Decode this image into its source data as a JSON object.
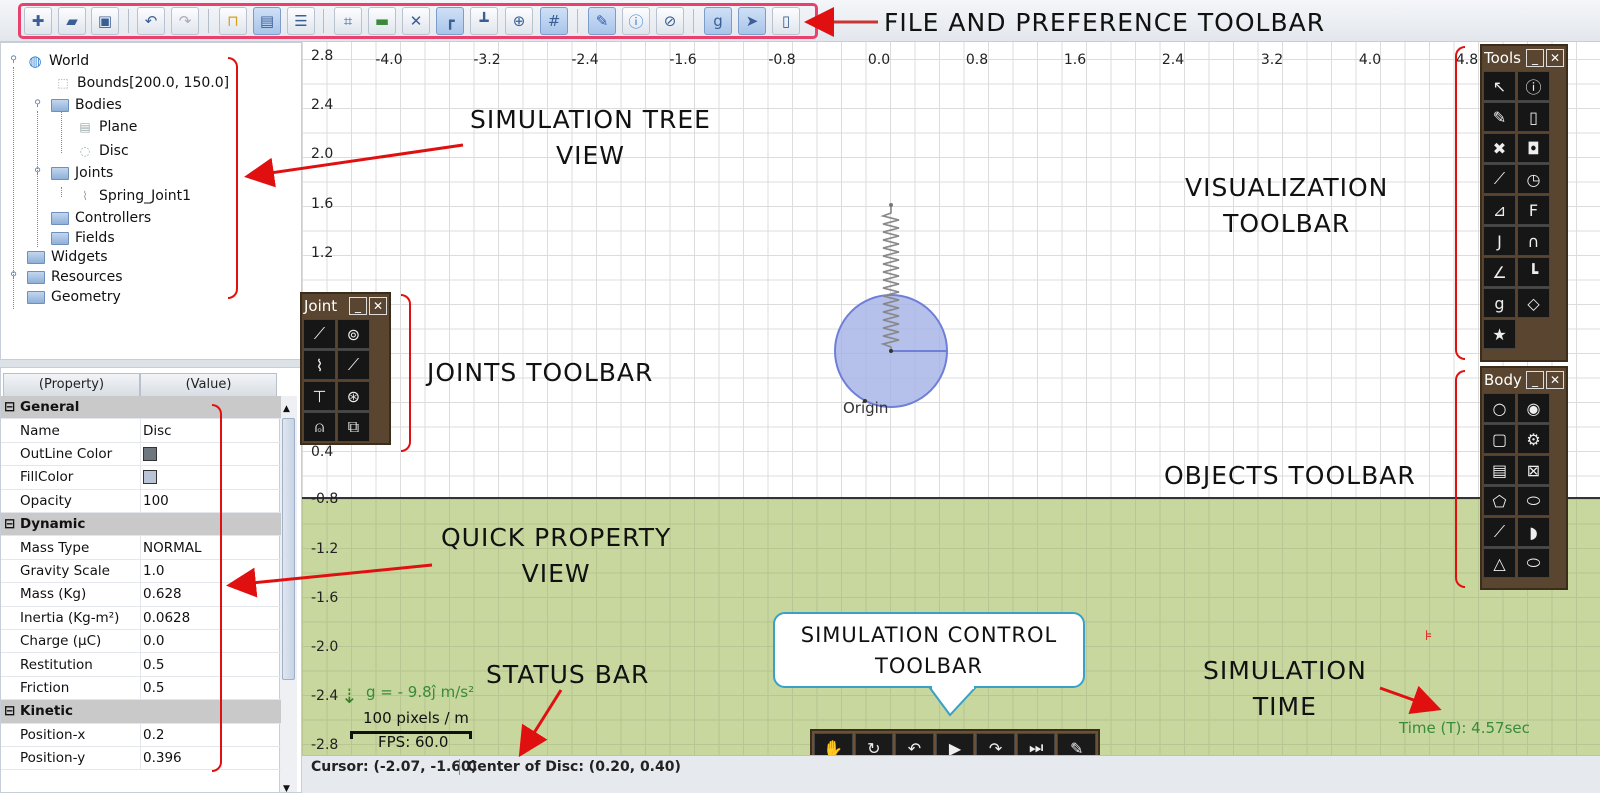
{
  "toolbar": {
    "icons": [
      "new-icon",
      "open-icon",
      "save-icon",
      "undo-icon",
      "redo-icon",
      "lock-icon",
      "preferences-icon",
      "settings-list-icon",
      "code-icon",
      "panel-icon",
      "tools-icon",
      "ruler-icon",
      "axes-icon",
      "snap-icon",
      "grid-icon",
      "pin-icon",
      "info-icon",
      "bandage-icon",
      "gravity-icon",
      "select-icon",
      "mouse-icon"
    ]
  },
  "annotations": {
    "file_toolbar": "FILE AND PREFERENCE TOOLBAR",
    "tree_view": "SIMULATION TREE\nVIEW",
    "visualization": "VISUALIZATION\nTOOLBAR",
    "joints": "JOINTS TOOLBAR",
    "objects": "OBJECTS TOOLBAR",
    "quick_property": "QUICK PROPERTY\nVIEW",
    "status_bar": "STATUS BAR",
    "sim_control": "SIMULATION CONTROL\nTOOLBAR",
    "sim_time": "SIMULATION\nTIME"
  },
  "tree": {
    "items": [
      {
        "label": "World"
      },
      {
        "label": "Bounds[200.0, 150.0]"
      },
      {
        "label": "Bodies"
      },
      {
        "label": "Plane"
      },
      {
        "label": "Disc"
      },
      {
        "label": "Joints"
      },
      {
        "label": "Spring_Joint1"
      },
      {
        "label": "Controllers"
      },
      {
        "label": "Fields"
      },
      {
        "label": "Widgets"
      },
      {
        "label": "Resources"
      },
      {
        "label": "Geometry"
      }
    ]
  },
  "props": {
    "header_property": "(Property)",
    "header_value": "(Value)",
    "groups": {
      "general": "General",
      "dynamic": "Dynamic",
      "kinetic": "Kinetic"
    },
    "rows": [
      {
        "k": "Name",
        "v": "Disc"
      },
      {
        "k": "OutLine Color",
        "v": ""
      },
      {
        "k": "FillColor",
        "v": ""
      },
      {
        "k": "Opacity",
        "v": "100"
      },
      {
        "k": "Mass Type",
        "v": "NORMAL"
      },
      {
        "k": "Gravity Scale",
        "v": "1.0"
      },
      {
        "k": "Mass (Kg)",
        "v": "0.628"
      },
      {
        "k": "Inertia (Kg-m²)",
        "v": "0.0628"
      },
      {
        "k": "Charge (µC)",
        "v": "0.0"
      },
      {
        "k": "Restitution",
        "v": "0.5"
      },
      {
        "k": "Friction",
        "v": "0.5"
      },
      {
        "k": "Position-x",
        "v": "0.2"
      },
      {
        "k": "Position-y",
        "v": "0.396"
      }
    ],
    "outline_color": "#6f7680",
    "fill_color": "#b9c4d6"
  },
  "canvas": {
    "x_ticks": [
      "-4.0",
      "-3.2",
      "-2.4",
      "-1.6",
      "-0.8",
      "0.0",
      "0.8",
      "1.6",
      "2.4",
      "3.2",
      "4.0",
      "4.8"
    ],
    "y_ticks": [
      "2.8",
      "2.4",
      "2.0",
      "1.6",
      "1.2",
      "0.4",
      "-0.8",
      "-1.2",
      "-1.6",
      "-2.0",
      "-2.4",
      "-2.8"
    ],
    "origin_label": "Origin",
    "gravity": "g = - 9.8ĵ m/s²",
    "scale": "100 pixels / m",
    "fps": "FPS: 60.0",
    "time": "Time (T): 4.57sec",
    "ground_color": "#c7d79e",
    "disc_color": "#a4b2e6"
  },
  "panels": {
    "joint_title": "Joint",
    "tools_title": "Tools",
    "body_title": "Body"
  },
  "status": {
    "cursor": "Cursor: (-2.07, -1.60)",
    "center": "Center of Disc: (0.20, 0.40)"
  }
}
